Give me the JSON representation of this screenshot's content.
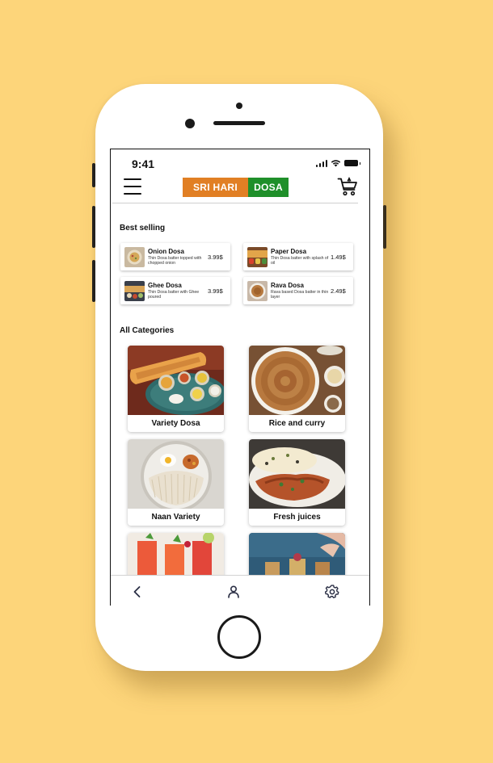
{
  "status_bar": {
    "time": "9:41"
  },
  "header": {
    "logo_left": "SRI HARI",
    "logo_right": "DOSA",
    "colors": {
      "logo_orange": "#e17f24",
      "logo_green": "#1f8f2a"
    }
  },
  "best_selling": {
    "title": "Best selling",
    "items": [
      {
        "name": "Onion Dosa",
        "desc": "Thin Dosa batter topped with chopped onion",
        "price": "3.99$"
      },
      {
        "name": "Paper Dosa",
        "desc": "Thin Dosa batter with splash of oil",
        "price": "1.49$"
      },
      {
        "name": "Ghee Dosa",
        "desc": "Thin Dosa batter with Ghee poured",
        "price": "3.99$"
      },
      {
        "name": "Rava Dosa",
        "desc": "Rava based Dosa batter in thin layer",
        "price": "2.49$"
      }
    ]
  },
  "categories": {
    "title": "All Categories",
    "items": [
      {
        "label": "Variety Dosa"
      },
      {
        "label": "Rice and curry"
      },
      {
        "label": "Naan Variety"
      },
      {
        "label": "Fresh juices"
      }
    ]
  },
  "bottom_nav": {
    "icons": [
      "back-icon",
      "profile-icon",
      "settings-icon"
    ]
  },
  "background_color": "#fdd57a"
}
